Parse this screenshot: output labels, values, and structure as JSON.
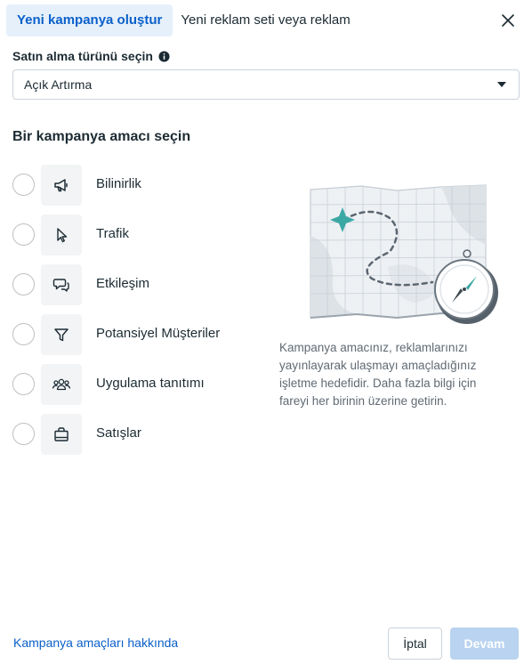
{
  "tabs": {
    "active": "Yeni kampanya oluştur",
    "other": "Yeni reklam seti veya reklam"
  },
  "purchase": {
    "label": "Satın alma türünü seçin",
    "info_icon": "info-icon",
    "selected": "Açık Artırma"
  },
  "objective": {
    "title": "Bir kampanya amacı seçin",
    "items": [
      {
        "label": "Bilinirlik",
        "icon": "megaphone-icon"
      },
      {
        "label": "Trafik",
        "icon": "cursor-icon"
      },
      {
        "label": "Etkileşim",
        "icon": "chat-bubbles-icon"
      },
      {
        "label": "Potansiyel Müşteriler",
        "icon": "funnel-icon"
      },
      {
        "label": "Uygulama tanıtımı",
        "icon": "people-icon"
      },
      {
        "label": "Satışlar",
        "icon": "shopping-bag-icon"
      }
    ]
  },
  "description": "Kampanya amacınız, reklamlarınızı yayınlayarak ulaşmayı amaçladığınız işletme hedefidir. Daha fazla bilgi için fareyi her birinin üzerine getirin.",
  "footer": {
    "link": "Kampanya amaçları hakkında",
    "cancel": "İptal",
    "next": "Devam"
  },
  "colors": {
    "accent": "#0a60c9",
    "tab_bg": "#e6f0fb",
    "disabled_btn": "#b9d3f0",
    "map_star": "#3ba8a4"
  }
}
